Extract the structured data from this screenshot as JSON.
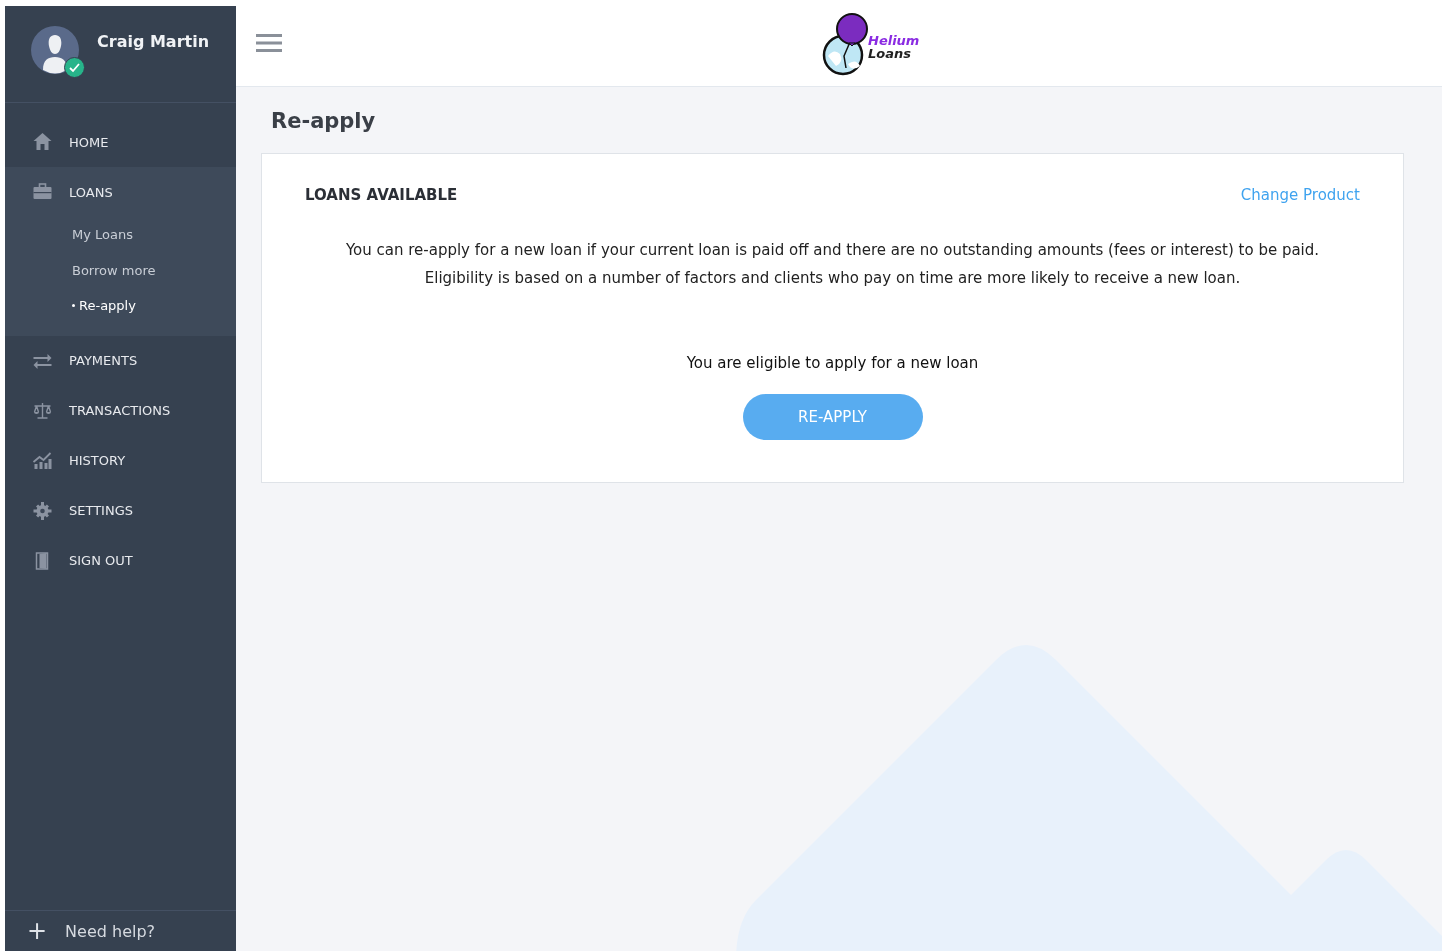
{
  "user": {
    "name": "Craig Martin",
    "verified": true
  },
  "nav": [
    {
      "label": "HOME",
      "kind": "home"
    },
    {
      "label": "LOANS",
      "kind": "briefcase",
      "expanded": true,
      "children": [
        {
          "label": "My Loans",
          "selected": false
        },
        {
          "label": "Borrow more",
          "selected": false
        },
        {
          "label": "Re-apply",
          "selected": true
        }
      ]
    },
    {
      "label": "PAYMENTS",
      "kind": "transfer"
    },
    {
      "label": "TRANSACTIONS",
      "kind": "scale"
    },
    {
      "label": "HISTORY",
      "kind": "chart"
    },
    {
      "label": "SETTINGS",
      "kind": "gear"
    },
    {
      "label": "SIGN OUT",
      "kind": "door"
    }
  ],
  "help": {
    "icon": "+",
    "label": "Need help?"
  },
  "logo": {
    "line1": "Helium",
    "line2": "Loans"
  },
  "page_title": "Re-apply",
  "card": {
    "heading": "LOANS AVAILABLE",
    "link": "Change Product",
    "description": [
      "You can re-apply for a new loan if your current loan is paid off and there are no outstanding amounts (fees or interest) to be paid.",
      "Eligibility is based on a number of factors and clients who pay on time are more likely to receive a new loan."
    ],
    "status": "You are eligible to apply for a new loan",
    "button": "RE-APPLY"
  }
}
